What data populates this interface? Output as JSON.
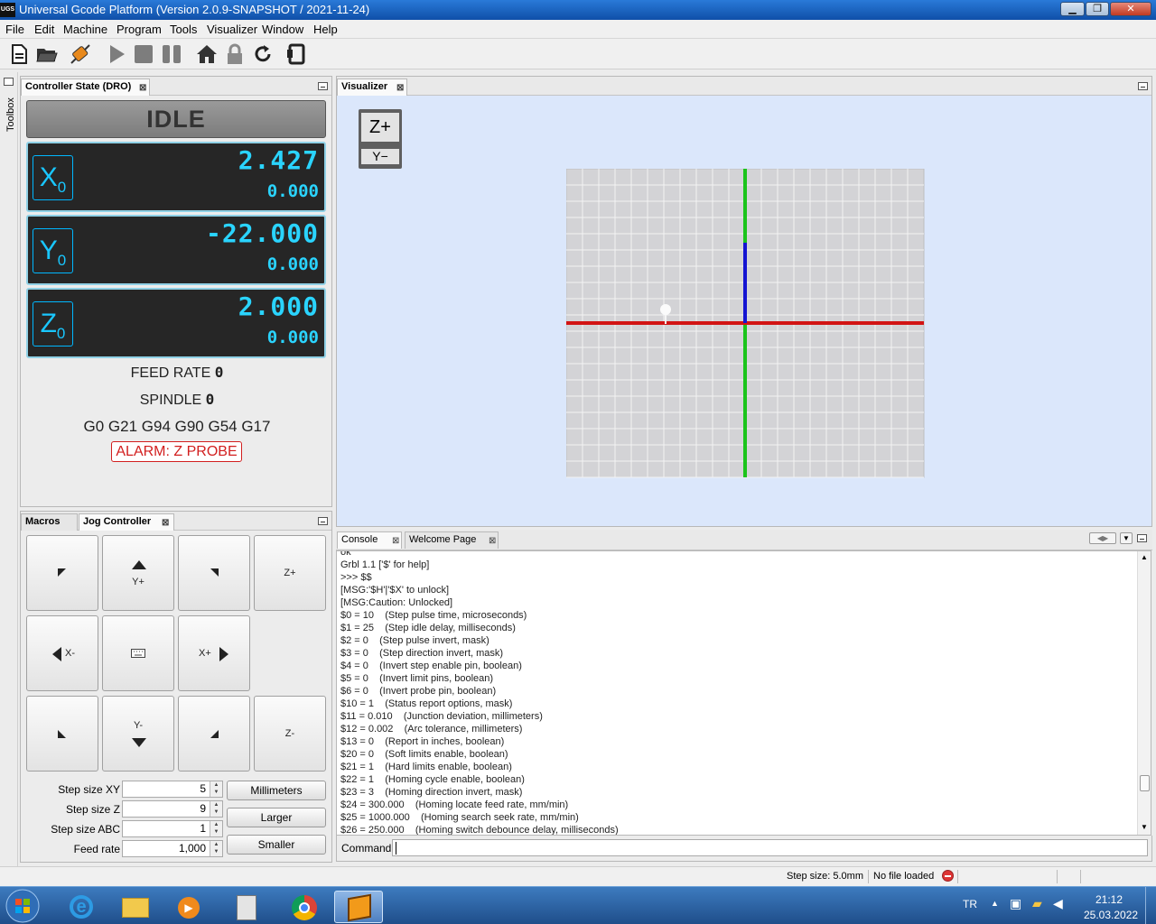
{
  "window": {
    "app_icon": "UGS",
    "title": "Universal Gcode Platform (Version 2.0.9-SNAPSHOT / 2021-11-24)",
    "controls": [
      "minimize-icon",
      "restore-icon",
      "close-icon"
    ]
  },
  "menu": [
    "File",
    "Edit",
    "Machine",
    "Program",
    "Tools",
    "Visualizer",
    "Window",
    "Help"
  ],
  "toolbar": [
    "new-file-icon",
    "open-folder-icon",
    "connect-icon",
    "play-icon",
    "stop-icon",
    "pause-icon",
    "home-icon",
    "lock-icon",
    "reset-icon",
    "soft-reset-icon"
  ],
  "sidebar": {
    "label": "Toolbox"
  },
  "dro": {
    "tab": "Controller State (DRO)",
    "state": "IDLE",
    "x": {
      "label": "X",
      "sub": "0",
      "machine": "2.427",
      "work": "0.000"
    },
    "y": {
      "label": "Y",
      "sub": "0",
      "machine": "-22.000",
      "work": "0.000"
    },
    "z": {
      "label": "Z",
      "sub": "0",
      "machine": "2.000",
      "work": "0.000"
    },
    "feed_label": "FEED RATE",
    "feed_value": "0",
    "spindle_label": "SPINDLE",
    "spindle_value": "0",
    "gcodes": "G0 G21 G94 G90 G54 G17",
    "alarm": "ALARM: Z PROBE"
  },
  "visualizer": {
    "tab": "Visualizer",
    "cube_top": "Z+",
    "cube_front": "Y−"
  },
  "jog": {
    "tabs": [
      "Macros",
      "Jog Controller"
    ],
    "buttons": {
      "yplus": "Y+",
      "zplus": "Z+",
      "xminus": "X-",
      "xplus": "X+",
      "yminus": "Y-",
      "zminus": "Z-"
    },
    "step_xy_label": "Step size XY",
    "step_xy": "5",
    "step_z_label": "Step size Z",
    "step_z": "9",
    "step_abc_label": "Step size ABC",
    "step_abc": "1",
    "feed_label": "Feed rate",
    "feed": "1,000",
    "units_button": "Millimeters",
    "larger_button": "Larger",
    "smaller_button": "Smaller"
  },
  "console": {
    "tabs": [
      "Console",
      "Welcome Page"
    ],
    "lines": [
      "ok",
      "Grbl 1.1 ['$' for help]",
      ">>> $$",
      "[MSG:'$H'|'$X' to unlock]",
      "[MSG:Caution: Unlocked]",
      "$0 = 10    (Step pulse time, microseconds)",
      "$1 = 25    (Step idle delay, milliseconds)",
      "$2 = 0    (Step pulse invert, mask)",
      "$3 = 0    (Step direction invert, mask)",
      "$4 = 0    (Invert step enable pin, boolean)",
      "$5 = 0    (Invert limit pins, boolean)",
      "$6 = 0    (Invert probe pin, boolean)",
      "$10 = 1    (Status report options, mask)",
      "$11 = 0.010    (Junction deviation, millimeters)",
      "$12 = 0.002    (Arc tolerance, millimeters)",
      "$13 = 0    (Report in inches, boolean)",
      "$20 = 0    (Soft limits enable, boolean)",
      "$21 = 1    (Hard limits enable, boolean)",
      "$22 = 1    (Homing cycle enable, boolean)",
      "$23 = 3    (Homing direction invert, mask)",
      "$24 = 300.000    (Homing locate feed rate, mm/min)",
      "$25 = 1000.000    (Homing search seek rate, mm/min)",
      "$26 = 250.000    (Homing switch debounce delay, milliseconds)"
    ],
    "command_label": "Command:",
    "command_value": ""
  },
  "status": {
    "step_size": "Step size: 5.0mm",
    "file": "No file loaded"
  },
  "taskbar": {
    "apps": [
      "start-orb-icon",
      "internet-explorer-icon",
      "file-explorer-icon",
      "media-player-icon",
      "calculator-icon",
      "chrome-icon",
      "ugs-icon"
    ],
    "lang": "TR",
    "time": "21:12",
    "date": "25.03.2022"
  }
}
